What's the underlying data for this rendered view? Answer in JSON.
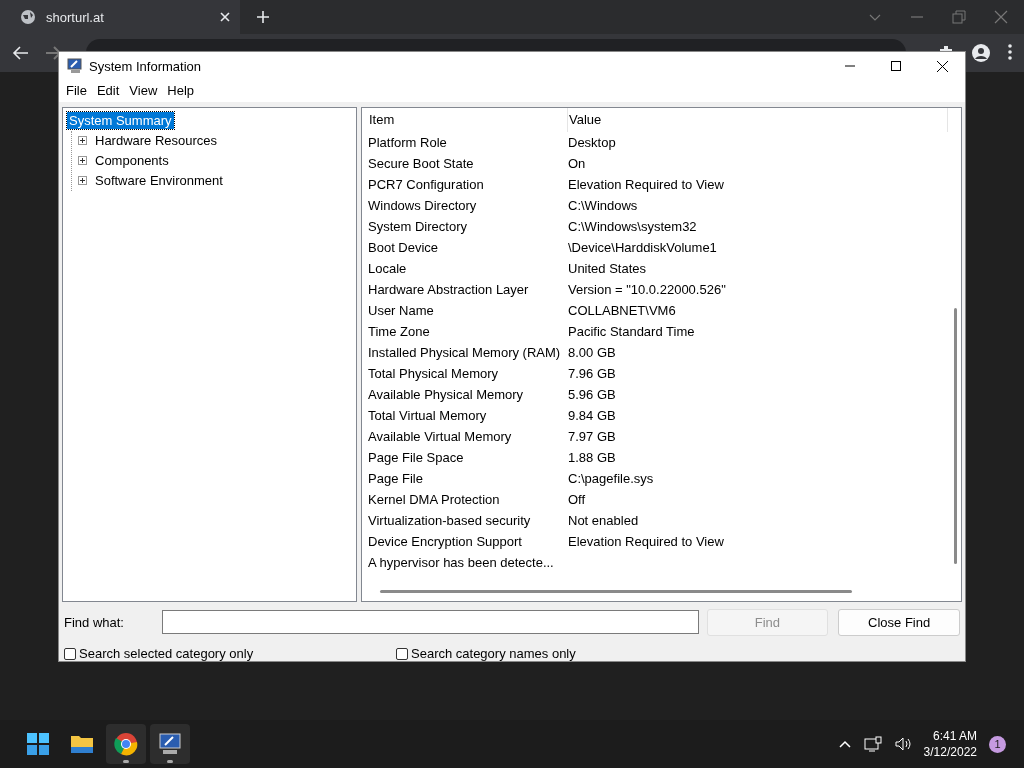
{
  "browser": {
    "tab": {
      "title": "shorturl.at"
    }
  },
  "window": {
    "title": "System Information",
    "menu": [
      "File",
      "Edit",
      "View",
      "Help"
    ],
    "tree": [
      {
        "label": "System Summary",
        "selected": true,
        "children": [
          {
            "label": "Hardware Resources",
            "selected": false,
            "expanded": false
          },
          {
            "label": "Components",
            "selected": false,
            "expanded": false
          },
          {
            "label": "Software Environment",
            "selected": false,
            "expanded": false
          }
        ]
      }
    ],
    "table": {
      "columns": [
        "Item",
        "Value"
      ],
      "rows": [
        [
          "Platform Role",
          "Desktop"
        ],
        [
          "Secure Boot State",
          "On"
        ],
        [
          "PCR7 Configuration",
          "Elevation Required to View"
        ],
        [
          "Windows Directory",
          "C:\\Windows"
        ],
        [
          "System Directory",
          "C:\\Windows\\system32"
        ],
        [
          "Boot Device",
          "\\Device\\HarddiskVolume1"
        ],
        [
          "Locale",
          "United States"
        ],
        [
          "Hardware Abstraction Layer",
          "Version = \"10.0.22000.526\""
        ],
        [
          "User Name",
          "COLLABNET\\VM6"
        ],
        [
          "Time Zone",
          "Pacific Standard Time"
        ],
        [
          "Installed Physical Memory (RAM)",
          "8.00 GB"
        ],
        [
          "Total Physical Memory",
          "7.96 GB"
        ],
        [
          "Available Physical Memory",
          "5.96 GB"
        ],
        [
          "Total Virtual Memory",
          "9.84 GB"
        ],
        [
          "Available Virtual Memory",
          "7.97 GB"
        ],
        [
          "Page File Space",
          "1.88 GB"
        ],
        [
          "Page File",
          "C:\\pagefile.sys"
        ],
        [
          "Kernel DMA Protection",
          "Off"
        ],
        [
          "Virtualization-based security",
          "Not enabled"
        ],
        [
          "Device Encryption Support",
          "Elevation Required to View"
        ],
        [
          "A hypervisor has been detecte...",
          ""
        ]
      ]
    },
    "find": {
      "label": "Find what:",
      "buttons": [
        {
          "label": "Find",
          "disabled": true
        },
        {
          "label": "Close Find",
          "disabled": false
        }
      ],
      "options": [
        {
          "label": "Search selected category only",
          "checked": false
        },
        {
          "label": "Search category names only",
          "checked": false
        }
      ]
    }
  },
  "taskbar": {
    "apps": [
      {
        "kind": "start",
        "running": false
      },
      {
        "kind": "folder",
        "running": false
      },
      {
        "kind": "browser",
        "running": true
      },
      {
        "kind": "sysinfo",
        "running": true
      }
    ],
    "time": "6:41 AM",
    "date": "3/12/2022",
    "notifications": "1"
  }
}
